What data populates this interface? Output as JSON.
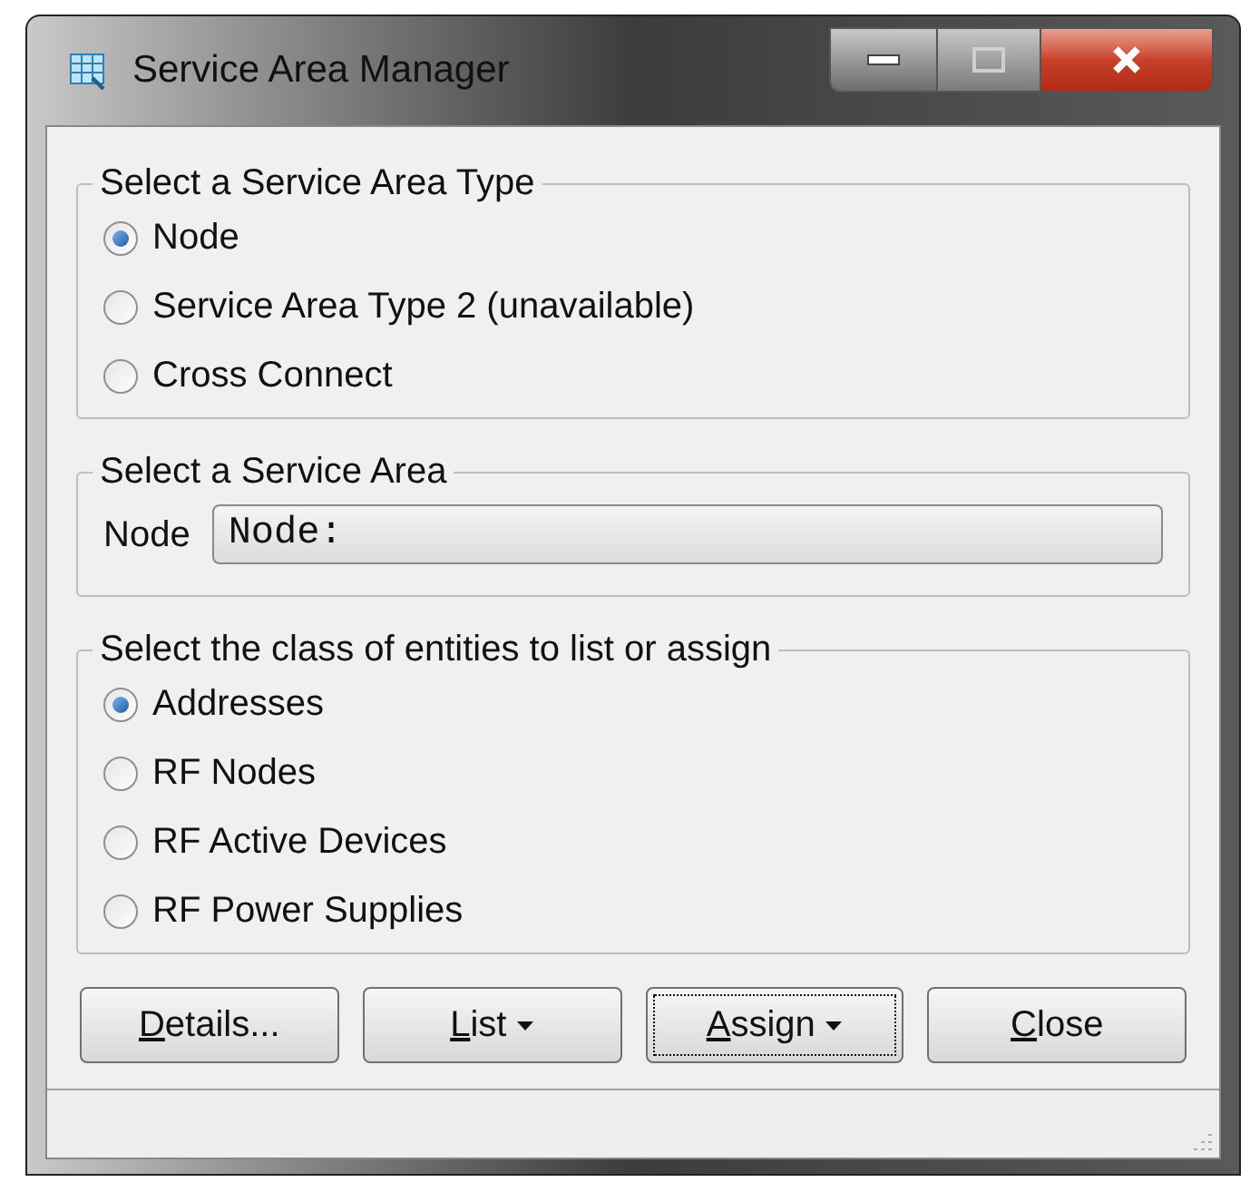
{
  "window": {
    "title": "Service Area Manager"
  },
  "groups": [
    {
      "kind": "radio",
      "title": "Select a Service Area Type",
      "options": [
        {
          "label": "Node",
          "selected": true
        },
        {
          "label": "Service Area Type 2 (unavailable)",
          "selected": false
        },
        {
          "label": "Cross Connect",
          "selected": false
        }
      ]
    },
    {
      "kind": "field",
      "title": "Select a Service Area",
      "field_label": "Node",
      "value": "Node:"
    },
    {
      "kind": "radio",
      "title": "Select the class of entities to list or assign",
      "options": [
        {
          "label": "Addresses",
          "selected": true
        },
        {
          "label": "RF Nodes",
          "selected": false
        },
        {
          "label": "RF Active Devices",
          "selected": false
        },
        {
          "label": "RF Power Supplies",
          "selected": false
        }
      ]
    }
  ],
  "buttons": [
    {
      "label": "Details...",
      "dropdown": false,
      "focused": false
    },
    {
      "label": "List",
      "dropdown": true,
      "focused": false
    },
    {
      "label": "Assign",
      "dropdown": true,
      "focused": true
    },
    {
      "label": "Close",
      "dropdown": false,
      "focused": false
    }
  ]
}
